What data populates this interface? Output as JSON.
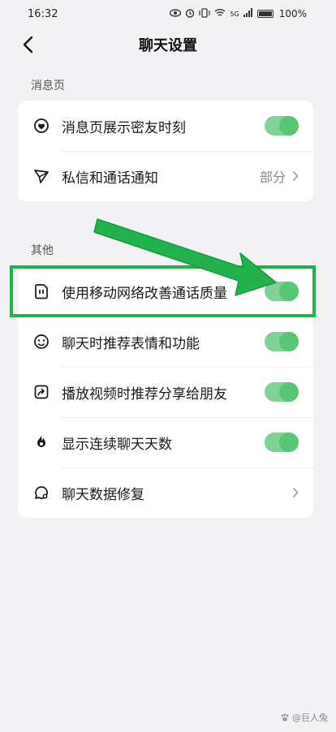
{
  "status": {
    "time": "16:32",
    "network": "5G",
    "battery": "100%"
  },
  "nav": {
    "title": "聊天设置"
  },
  "sections": [
    {
      "label": "消息页",
      "rows": [
        {
          "label": "消息页展示密友时刻",
          "control": "toggle",
          "on": true,
          "icon": "heart-pin-icon"
        },
        {
          "label": "私信和通话通知",
          "control": "value",
          "value": "部分",
          "icon": "send-icon"
        }
      ]
    },
    {
      "label": "其他",
      "rows": [
        {
          "label": "使用移动网络改善通话质量",
          "control": "toggle",
          "on": true,
          "icon": "sim-card-icon"
        },
        {
          "label": "聊天时推荐表情和功能",
          "control": "toggle",
          "on": true,
          "icon": "smile-icon"
        },
        {
          "label": "播放视频时推荐分享给朋友",
          "control": "toggle",
          "on": true,
          "icon": "share-icon"
        },
        {
          "label": "显示连续聊天天数",
          "control": "toggle",
          "on": true,
          "icon": "flame-icon"
        },
        {
          "label": "聊天数据修复",
          "control": "chevron",
          "icon": "chat-repair-icon"
        }
      ]
    }
  ],
  "annotation": {
    "color": "#22b14c"
  },
  "watermark": {
    "text": "@巨人兔"
  },
  "colors": {
    "toggle_on_track": "#7fd196",
    "toggle_on_knob": "#5ac574",
    "background": "#f2f2f4"
  }
}
